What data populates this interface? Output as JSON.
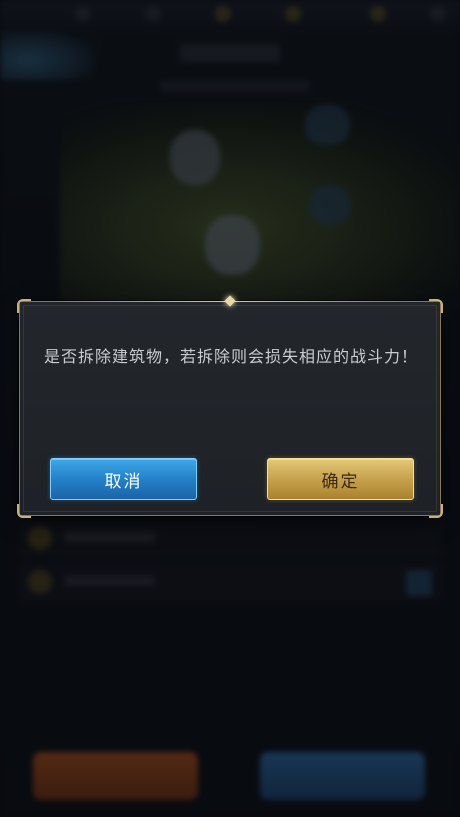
{
  "dialog": {
    "message": "是否拆除建筑物，若拆除则会损失相应的战斗力！",
    "cancel_label": "取消",
    "confirm_label": "确定"
  },
  "colors": {
    "cancel_button": "#2481c9",
    "confirm_button": "#c7a24c",
    "dialog_border": "#8a7a4a",
    "dialog_bg": "#202429"
  }
}
